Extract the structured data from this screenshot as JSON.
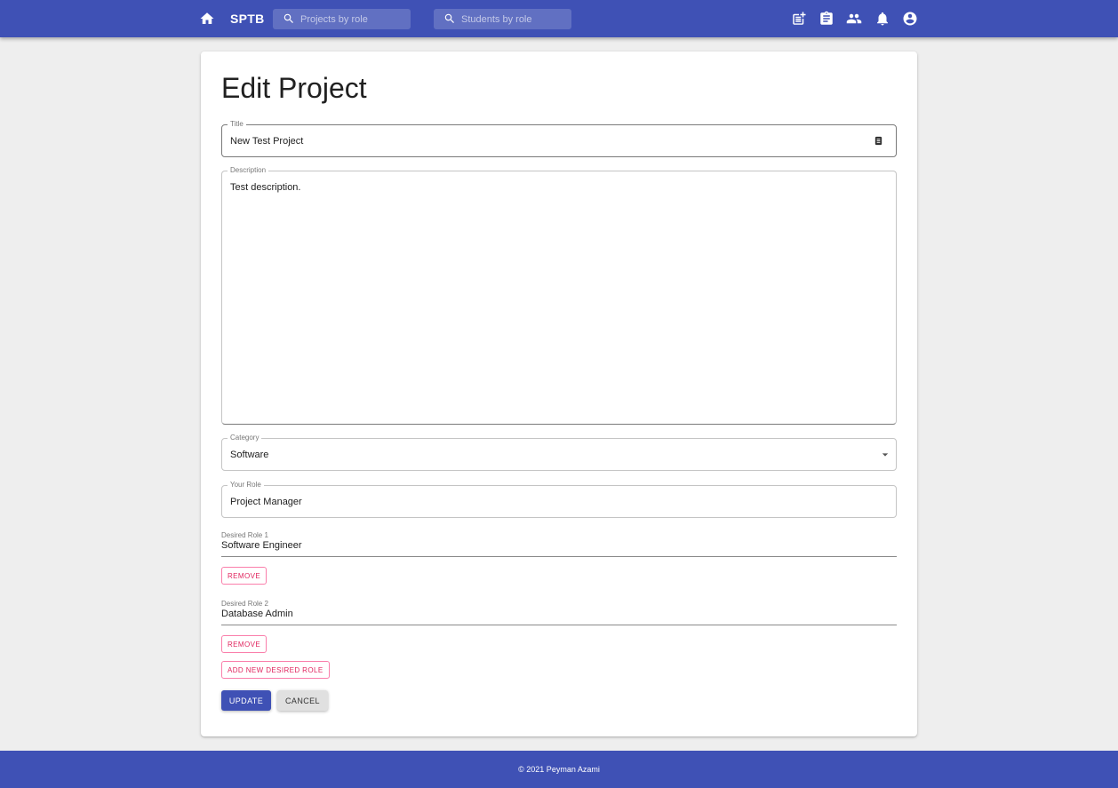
{
  "nav": {
    "brand": "SPTB",
    "search_projects_placeholder": "Projects by role",
    "search_students_placeholder": "Students by role",
    "icons": [
      "home-icon",
      "add-post-icon",
      "clipboard-icon",
      "people-icon",
      "notifications-icon",
      "account-icon"
    ]
  },
  "form": {
    "heading": "Edit Project",
    "title_label": "Title",
    "title_value": "New Test Project",
    "description_label": "Description",
    "description_value": "Test description.",
    "category_label": "Category",
    "category_value": "Software",
    "your_role_label": "Your Role",
    "your_role_value": "Project Manager",
    "desired_roles": [
      {
        "label": "Desired Role 1",
        "value": "Software Engineer",
        "remove_label": "REMOVE"
      },
      {
        "label": "Desired Role 2",
        "value": "Database Admin",
        "remove_label": "REMOVE"
      }
    ],
    "add_role_label": "ADD NEW DESIRED ROLE",
    "update_label": "UPDATE",
    "cancel_label": "CANCEL"
  },
  "footer": {
    "text": "© 2021 Peyman Azami"
  },
  "colors": {
    "primary": "#3f51b5",
    "secondary": "#f50057",
    "background": "#eeeeee"
  }
}
